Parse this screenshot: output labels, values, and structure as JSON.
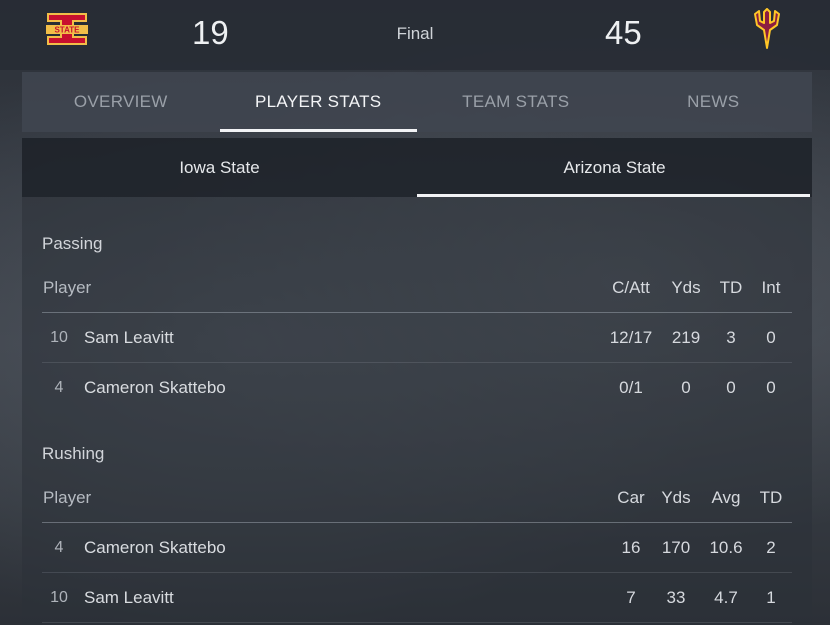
{
  "scoreboard": {
    "home_score": "19",
    "away_score": "45",
    "status": "Final",
    "home_logo_text": "STATE",
    "colors": {
      "isu_red": "#c8102e",
      "isu_gold": "#f1be48",
      "asu_maroon": "#8c1d40",
      "asu_gold": "#ffc627"
    }
  },
  "tabs": [
    "OVERVIEW",
    "PLAYER STATS",
    "TEAM STATS",
    "NEWS"
  ],
  "team_tabs": [
    "Iowa State",
    "Arizona State"
  ],
  "passing": {
    "title": "Passing",
    "headers": [
      "Player",
      "C/Att",
      "Yds",
      "TD",
      "Int"
    ],
    "rows": [
      {
        "jersey": "10",
        "name": "Sam Leavitt",
        "stats": [
          "12/17",
          "219",
          "3",
          "0"
        ]
      },
      {
        "jersey": "4",
        "name": "Cameron Skattebo",
        "stats": [
          "0/1",
          "0",
          "0",
          "0"
        ]
      }
    ]
  },
  "rushing": {
    "title": "Rushing",
    "headers": [
      "Player",
      "Car",
      "Yds",
      "Avg",
      "TD"
    ],
    "rows": [
      {
        "jersey": "4",
        "name": "Cameron Skattebo",
        "stats": [
          "16",
          "170",
          "10.6",
          "2"
        ]
      },
      {
        "jersey": "10",
        "name": "Sam Leavitt",
        "stats": [
          "7",
          "33",
          "4.7",
          "1"
        ]
      }
    ]
  }
}
